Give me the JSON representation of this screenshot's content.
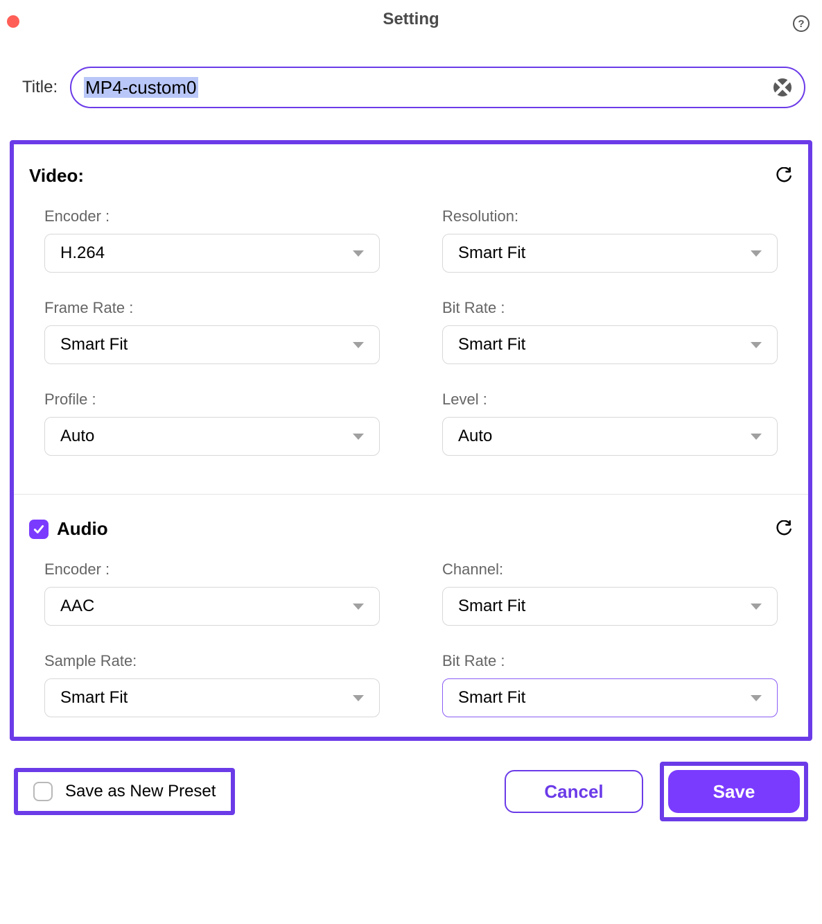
{
  "window": {
    "title": "Setting"
  },
  "title_field": {
    "label": "Title:",
    "value": "MP4-custom0"
  },
  "video": {
    "title": "Video:",
    "fields": {
      "encoder": {
        "label": "Encoder :",
        "value": "H.264"
      },
      "resolution": {
        "label": "Resolution:",
        "value": "Smart Fit"
      },
      "framerate": {
        "label": "Frame Rate :",
        "value": "Smart Fit"
      },
      "bitrate": {
        "label": "Bit Rate :",
        "value": "Smart Fit"
      },
      "profile": {
        "label": "Profile :",
        "value": "Auto"
      },
      "level": {
        "label": "Level :",
        "value": "Auto"
      }
    }
  },
  "audio": {
    "title": "Audio",
    "enabled": true,
    "fields": {
      "encoder": {
        "label": "Encoder :",
        "value": "AAC"
      },
      "channel": {
        "label": "Channel:",
        "value": "Smart Fit"
      },
      "samplerate": {
        "label": "Sample Rate:",
        "value": "Smart Fit"
      },
      "bitrate": {
        "label": "Bit Rate :",
        "value": "Smart Fit"
      }
    }
  },
  "footer": {
    "save_preset": "Save as New Preset",
    "cancel": "Cancel",
    "save": "Save"
  }
}
